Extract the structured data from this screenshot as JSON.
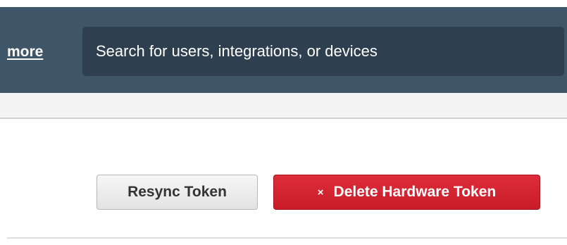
{
  "header": {
    "more_link": "more",
    "search": {
      "placeholder": "Search for users, integrations, or devices",
      "value": ""
    }
  },
  "actions": {
    "resync_label": "Resync Token",
    "delete_label": "Delete Hardware Token",
    "delete_icon": "×"
  },
  "colors": {
    "header_bg": "#3f5568",
    "search_bg": "#2e3f4f",
    "danger": "#d32430"
  }
}
